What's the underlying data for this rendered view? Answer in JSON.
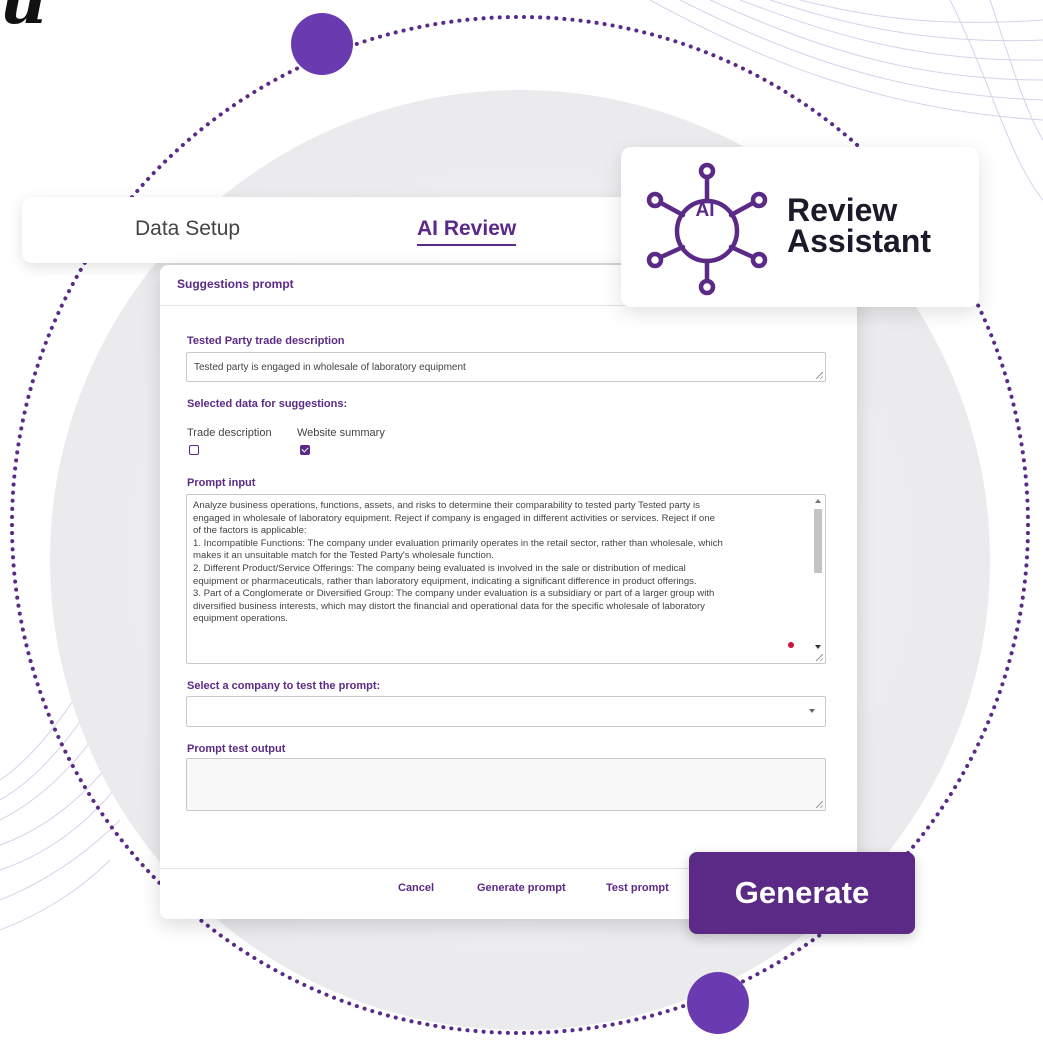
{
  "corner_glyph": "u",
  "tabs": [
    {
      "label": "Data Setup",
      "active": false
    },
    {
      "label": "AI Review",
      "active": true
    }
  ],
  "badge": {
    "logo_text": "AI",
    "title_line1": "Review",
    "title_line2": "Assistant",
    "logo_icon": "network-nodes-icon"
  },
  "dialog": {
    "title": "Suggestions prompt",
    "trade_desc_label": "Tested Party trade description",
    "trade_desc_value": "Tested party is engaged in wholesale of laboratory equipment",
    "selected_data_label": "Selected data for suggestions:",
    "options": [
      {
        "label": "Trade description",
        "checked": false
      },
      {
        "label": "Website summary",
        "checked": true
      }
    ],
    "prompt_input_label": "Prompt input",
    "prompt_lines": [
      "Analyze business operations, functions, assets, and risks to determine their comparability to tested party Tested party is",
      "engaged in wholesale of laboratory equipment. Reject if company is engaged in different activities or services. Reject if one",
      "of the factors is applicable:",
      "1. Incompatible Functions: The company under evaluation primarily operates in the retail sector, rather than wholesale, which",
      "makes it an unsuitable match for the Tested Party's wholesale function.",
      "2. Different Product/Service Offerings: The company being evaluated is involved in the sale or distribution of medical",
      "equipment or pharmaceuticals, rather than laboratory equipment, indicating a significant difference in product offerings.",
      "3. Part of a Conglomerate or Diversified Group: The company under evaluation is a subsidiary or part of a larger group with",
      "diversified business interests, which may distort the financial and operational data for the specific wholesale of laboratory",
      "equipment operations."
    ],
    "select_company_label": "Select a company to test the prompt:",
    "select_company_value": "",
    "test_output_label": "Prompt test output",
    "test_output_value": "",
    "buttons": {
      "cancel": "Cancel",
      "generate_prompt": "Generate prompt",
      "test_prompt": "Test prompt"
    }
  },
  "generate_button": "Generate",
  "colors": {
    "brand_purple": "#5b2a86",
    "dot_purple": "#6a3bb0",
    "spellcheck_red": "#d0103a"
  }
}
